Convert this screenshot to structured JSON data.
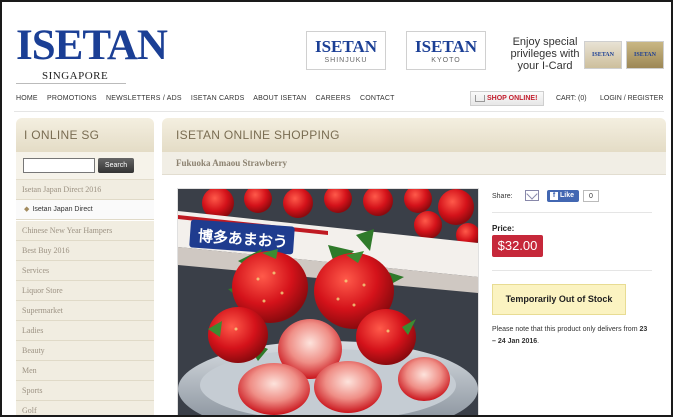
{
  "header": {
    "logo_main": "ISETAN",
    "logo_sub": "SINGAPORE",
    "stores": [
      {
        "name": "ISETAN",
        "location": "SHINJUKU"
      },
      {
        "name": "ISETAN",
        "location": "KYOTO"
      }
    ],
    "promo_lines": [
      "Enjoy special",
      "privileges with",
      "your I-Card"
    ],
    "card_names": [
      "ISETAN",
      "ISETAN"
    ]
  },
  "nav": {
    "items": [
      "HOME",
      "PROMOTIONS",
      "NEWSLETTERS / ADS",
      "ISETAN CARDS",
      "ABOUT ISETAN",
      "CAREERS",
      "CONTACT"
    ],
    "shop_online": "SHOP ONLINE!",
    "cart": "CART: (0)",
    "login": "LOGIN / REGISTER"
  },
  "sidebar": {
    "title": "I ONLINE SG",
    "search_button": "Search",
    "search_value": "",
    "items": [
      {
        "label": "Isetan Japan Direct 2016",
        "sub": false
      },
      {
        "label": "Isetan Japan Direct",
        "sub": true
      },
      {
        "label": "Chinese New Year Hampers",
        "sub": false
      },
      {
        "label": "Best Buy 2016",
        "sub": false
      },
      {
        "label": "Services",
        "sub": false
      },
      {
        "label": "Liquor Store",
        "sub": false
      },
      {
        "label": "Supermarket",
        "sub": false
      },
      {
        "label": "Ladies",
        "sub": false
      },
      {
        "label": "Beauty",
        "sub": false
      },
      {
        "label": "Men",
        "sub": false
      },
      {
        "label": "Sports",
        "sub": false
      },
      {
        "label": "Golf",
        "sub": false
      }
    ]
  },
  "main": {
    "title": "ISETAN ONLINE SHOPPING",
    "product_name": "Fukuoka Amaou Strawberry",
    "box_text": "博多あまおう",
    "share_label": "Share:",
    "fb_like": "Like",
    "fb_count": "0",
    "price_label": "Price:",
    "price": "$32.00",
    "stock_status": "Temporarily Out of Stock",
    "note_pre": "Please note that this product only delivers from ",
    "note_dates": "23 – 24 Jan 2016",
    "note_post": "."
  },
  "colors": {
    "brand_blue": "#1b3f95",
    "price_red": "#c6283a",
    "stock_yellow": "#fbf3c1",
    "panel_beige": "#e4dcc6"
  },
  "icons": [
    "cart-icon",
    "mail-icon",
    "facebook-icon"
  ]
}
